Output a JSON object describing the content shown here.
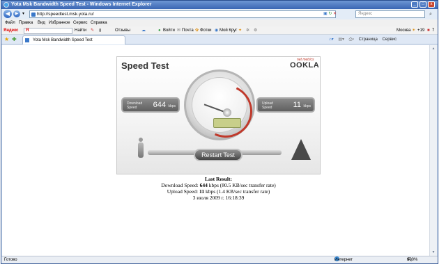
{
  "window": {
    "title": "Yota Msk Bandwidth Speed Test - Windows Internet Explorer",
    "minimize": "_",
    "maximize": "□",
    "close": "x"
  },
  "address_bar": {
    "url": "http://speedtest.msk.yota.ru/",
    "search_placeholder": "Яндекс",
    "back": "◀",
    "forward": "▶"
  },
  "menu": [
    "Файл",
    "Правка",
    "Вид",
    "Избранное",
    "Сервис",
    "Справка"
  ],
  "yandex_toolbar": {
    "brand": "Яндекс",
    "search_value": "Я",
    "find_label": "Найти",
    "reviews": "Отзывы",
    "login": "Войти",
    "mail": "Почта",
    "photos": "Фотки",
    "my_circle": "Мой Круг",
    "city": "Москва",
    "temperature": "+19",
    "count": "7"
  },
  "tabs": [
    {
      "label": "Yota Msk Bandwidth Speed Test"
    }
  ],
  "command_bar": {
    "page": "Страница",
    "tools": "Сервис"
  },
  "speedtest": {
    "title": "Speed Test",
    "brand": "OOKLA",
    "brand_tag": "net metrics",
    "download": {
      "label": "Download Speed",
      "value": "644",
      "unit": "kbps"
    },
    "upload": {
      "label": "Upload Speed",
      "value": "11",
      "unit": "kbps"
    },
    "restart_label": "Restart Test"
  },
  "results": {
    "heading": "Last Result:",
    "download_prefix": "Download Speed:",
    "download_value": "644",
    "download_suffix": "kbps (80.5 KB/sec transfer rate)",
    "upload_prefix": "Upload Speed:",
    "upload_value": "11",
    "upload_suffix": "kbps (1.4 KB/sec transfer rate)",
    "timestamp": "3 июля 2009 г. 16:18:39"
  },
  "status_bar": {
    "status": "Готово",
    "zone": "Интернет",
    "zoom": "100%"
  }
}
